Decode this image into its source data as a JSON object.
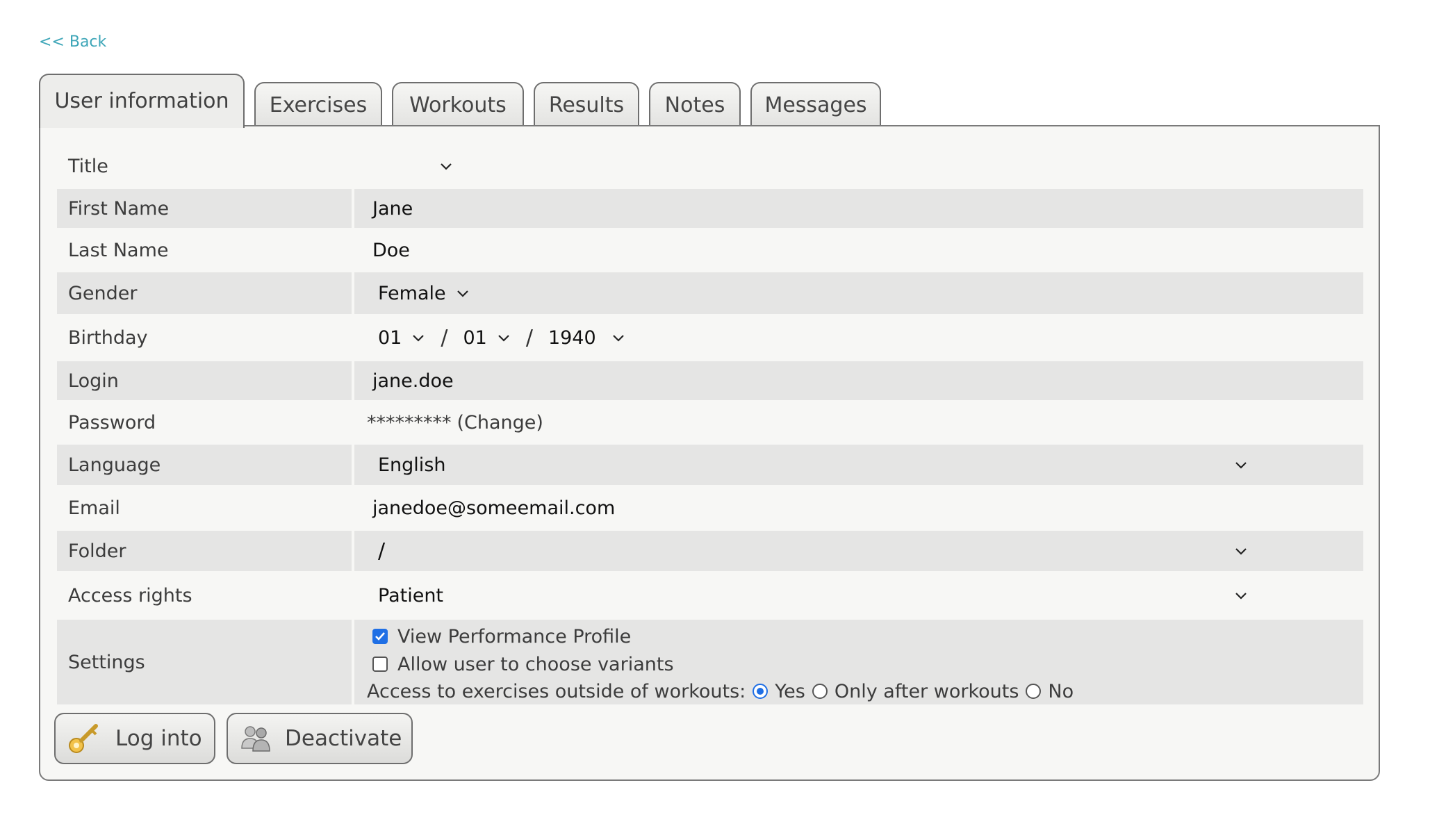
{
  "nav": {
    "back_label": "<< Back"
  },
  "tabs": [
    {
      "label": "User information",
      "active": true
    },
    {
      "label": "Exercises"
    },
    {
      "label": "Workouts"
    },
    {
      "label": "Results"
    },
    {
      "label": "Notes"
    },
    {
      "label": "Messages"
    }
  ],
  "form": {
    "title": {
      "label": "Title",
      "value": ""
    },
    "first_name": {
      "label": "First Name",
      "value": "Jane"
    },
    "last_name": {
      "label": "Last Name",
      "value": "Doe"
    },
    "gender": {
      "label": "Gender",
      "value": "Female"
    },
    "birthday": {
      "label": "Birthday",
      "day": "01",
      "month": "01",
      "year": "1940",
      "separator": "/"
    },
    "login": {
      "label": "Login",
      "value": "jane.doe"
    },
    "password": {
      "label": "Password",
      "masked": "*********",
      "change_label": "(Change)"
    },
    "language": {
      "label": "Language",
      "value": "English"
    },
    "email": {
      "label": "Email",
      "value": "janedoe@someemail.com"
    },
    "folder": {
      "label": "Folder",
      "value": "/"
    },
    "access_rights": {
      "label": "Access rights",
      "value": "Patient"
    },
    "settings": {
      "label": "Settings",
      "view_performance_label": "View Performance Profile",
      "view_performance_checked": true,
      "allow_variants_label": "Allow user to choose variants",
      "allow_variants_checked": false,
      "access_label": "Access to exercises outside of workouts:",
      "access_options": [
        "Yes",
        "Only after workouts",
        "No"
      ],
      "access_selected": "Yes"
    }
  },
  "actions": {
    "log_into_label": "Log into",
    "deactivate_label": "Deactivate"
  },
  "colors": {
    "accent": "#1f6fe5",
    "link": "#3ea6b8",
    "row_shade": "#e5e5e4",
    "panel_bg": "#f7f7f5"
  }
}
